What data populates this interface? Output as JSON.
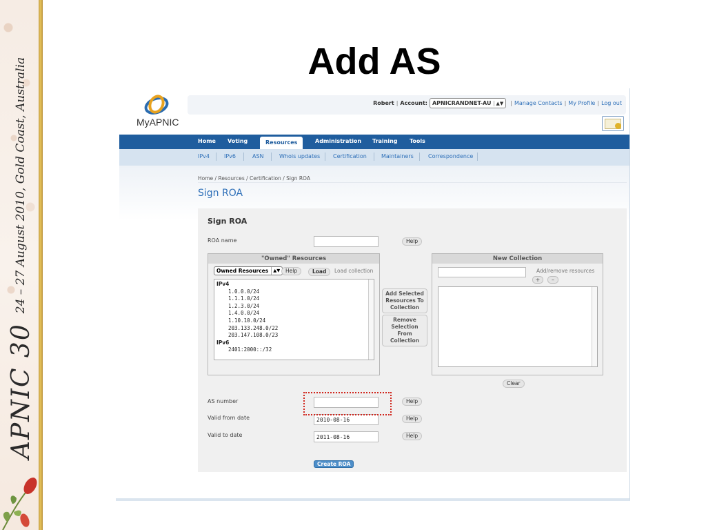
{
  "slide": {
    "title": "Add AS",
    "sidebar_text": "APNIC 30",
    "sidebar_event": "24 – 27 August 2010, Gold Coast, Australia"
  },
  "branding": {
    "logo_text": "MyAPNIC",
    "accent": "#1f5d9e",
    "link_color": "#2d6fb8"
  },
  "topbar": {
    "user": "Robert",
    "account_label": "Account:",
    "account_value": "APNICRANDNET-AU",
    "links": [
      "Manage Contacts",
      "My Profile",
      "Log out"
    ],
    "certificate_icon": "certificate-icon"
  },
  "nav": {
    "main": [
      "Home",
      "Voting",
      "Resources",
      "Administration",
      "Training",
      "Tools"
    ],
    "active": "Resources",
    "sub": [
      "IPv4",
      "IPv6",
      "ASN",
      "Whois updates",
      "Certification",
      "Maintainers",
      "Correspondence"
    ]
  },
  "breadcrumb": "Home / Resources / Certification / Sign ROA",
  "page_heading": "Sign ROA",
  "form": {
    "title": "Sign ROA",
    "roa_name_label": "ROA name",
    "roa_name_value": "",
    "help_label": "Help",
    "owned": {
      "title": "\"Owned\" Resources",
      "select_value": "Owned Resources",
      "help_label": "Help",
      "load_label": "Load",
      "load_collection_label": "Load collection",
      "ipv4_label": "IPv4",
      "ipv4": [
        "1.0.0.0/24",
        "1.1.1.0/24",
        "1.2.3.0/24",
        "1.4.0.0/24",
        "1.10.10.0/24",
        "203.133.248.0/22",
        "203.147.108.0/23"
      ],
      "ipv6_label": "IPv6",
      "ipv6": [
        "2401:2000::/32"
      ]
    },
    "add_selected_label": "Add Selected Resources To Collection",
    "remove_selection_label": "Remove Selection From Collection",
    "new_collection": {
      "title": "New Collection",
      "add_remove_label": "Add/remove resources",
      "add_symbol": "+",
      "remove_symbol": "–",
      "clear_label": "Clear"
    },
    "as_number_label": "AS number",
    "as_number_value": "",
    "valid_from_label": "Valid from date",
    "valid_from_value": "2010-08-16",
    "valid_to_label": "Valid to date",
    "valid_to_value": "2011-08-16",
    "create_label": "Create ROA"
  }
}
